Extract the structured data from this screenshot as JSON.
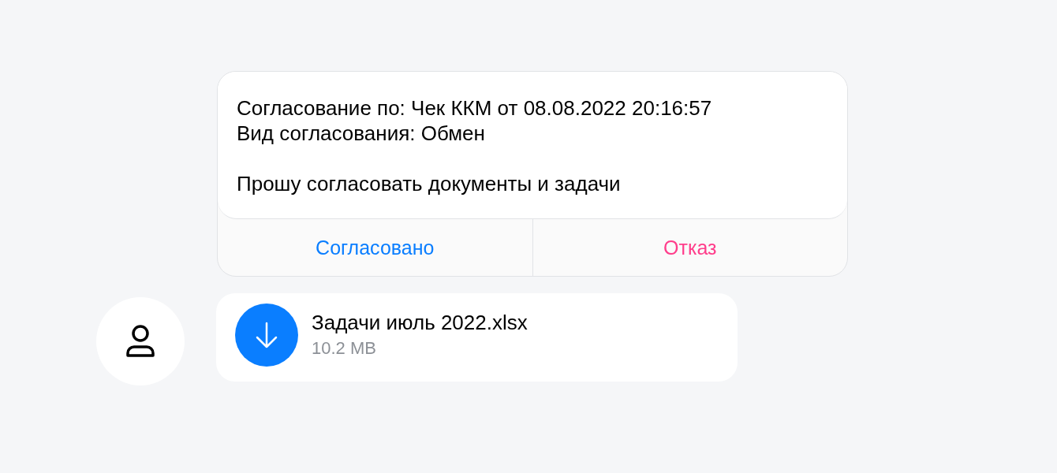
{
  "message": {
    "lines": [
      "Согласование по: Чек ККМ от 08.08.2022 20:16:57",
      "Вид согласования: Обмен"
    ],
    "request": "Прошу согласовать документы и задачи",
    "actions": [
      {
        "label": "Согласовано",
        "kind": "approve"
      },
      {
        "label": "Отказ",
        "kind": "reject"
      }
    ]
  },
  "attachment": {
    "file_name": "Задачи июль 2022.xlsx",
    "size": "10.2 MB"
  }
}
